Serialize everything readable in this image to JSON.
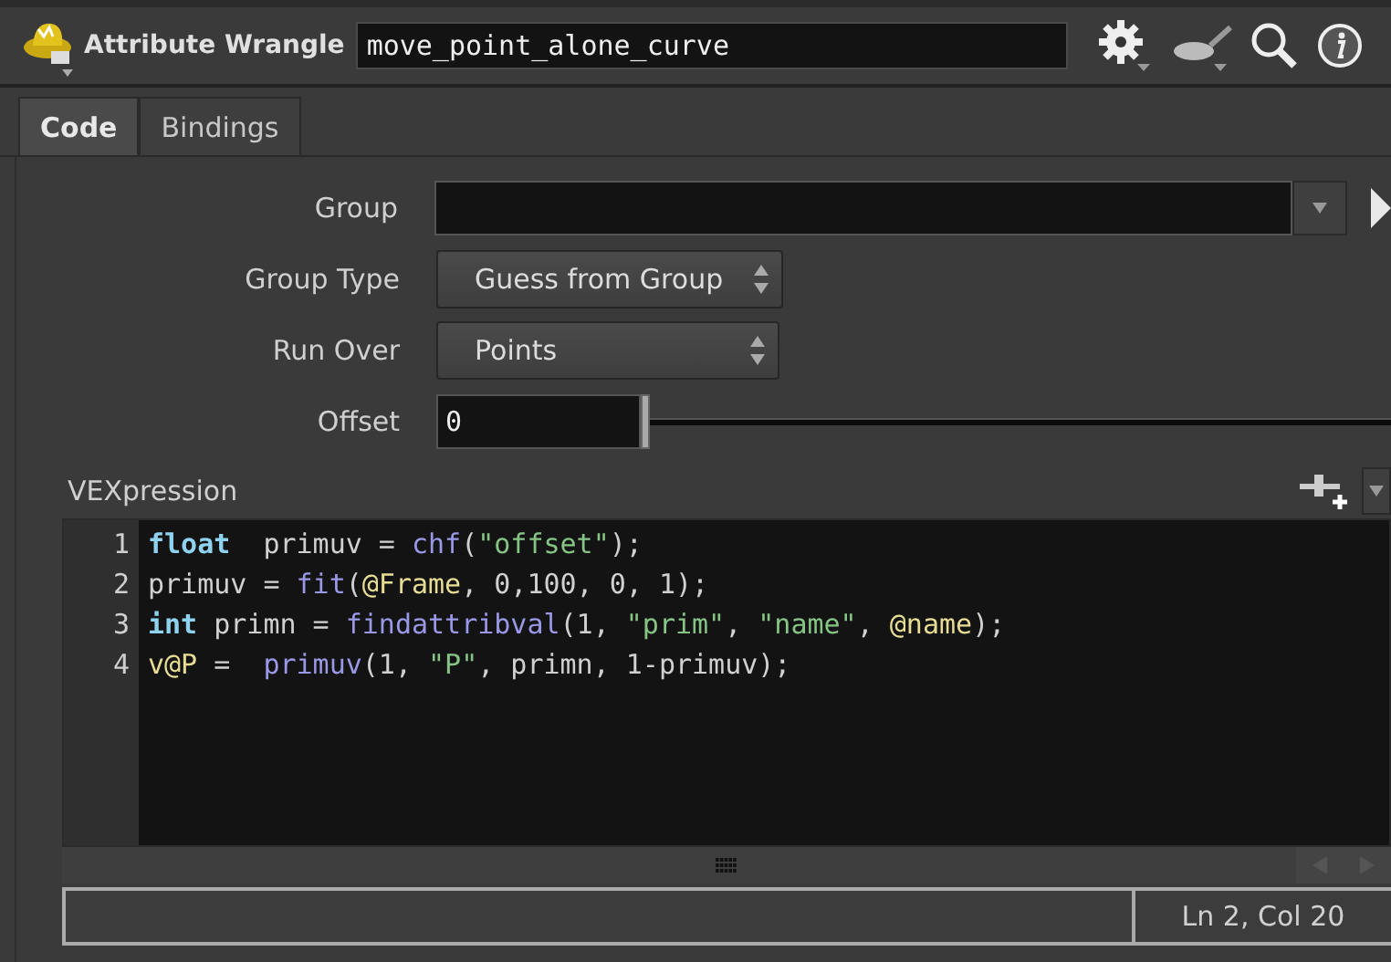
{
  "node": {
    "type_label": "Attribute Wrangle",
    "name": "move_point_alone_curve"
  },
  "tabs": [
    {
      "label": "Code",
      "selected": true
    },
    {
      "label": "Bindings",
      "selected": false
    }
  ],
  "parameters": [
    {
      "kind": "field",
      "label": "Group"
    },
    {
      "kind": "menu",
      "label": "Group Type",
      "value": "Guess from Group"
    },
    {
      "kind": "menu",
      "label": "Run Over",
      "value": "Points"
    },
    {
      "kind": "slider",
      "label": "Offset",
      "value": "0",
      "level": 0
    }
  ],
  "editor": {
    "label": "VEXpression",
    "lines": [
      {
        "number": "1",
        "tokens": [
          {
            "kind": "keyword",
            "text": "float"
          },
          {
            "kind": "plain",
            "text": "  primuv = "
          },
          {
            "kind": "function",
            "text": "chf"
          },
          {
            "kind": "plain",
            "text": "("
          },
          {
            "kind": "string",
            "text": "\"offset\""
          },
          {
            "kind": "plain",
            "text": ");"
          }
        ]
      },
      {
        "number": "2",
        "tokens": [
          {
            "kind": "plain",
            "text": "primuv = "
          },
          {
            "kind": "function",
            "text": "fit"
          },
          {
            "kind": "plain",
            "text": "("
          },
          {
            "kind": "attribute",
            "text": "@Frame"
          },
          {
            "kind": "plain",
            "text": ", 0,100, 0, 1);"
          }
        ]
      },
      {
        "number": "3",
        "tokens": [
          {
            "kind": "keyword",
            "text": "int"
          },
          {
            "kind": "plain",
            "text": " primn = "
          },
          {
            "kind": "function",
            "text": "findattribval"
          },
          {
            "kind": "plain",
            "text": "(1, "
          },
          {
            "kind": "string",
            "text": "\"prim\""
          },
          {
            "kind": "plain",
            "text": ", "
          },
          {
            "kind": "string",
            "text": "\"name\""
          },
          {
            "kind": "plain",
            "text": ", "
          },
          {
            "kind": "attribute",
            "text": "@name"
          },
          {
            "kind": "plain",
            "text": ");"
          }
        ]
      },
      {
        "number": "4",
        "tokens": [
          {
            "kind": "attribute",
            "text": "v@P"
          },
          {
            "kind": "plain",
            "text": " =  "
          },
          {
            "kind": "function",
            "text": "primuv"
          },
          {
            "kind": "plain",
            "text": "(1, "
          },
          {
            "kind": "string",
            "text": "\"P\""
          },
          {
            "kind": "plain",
            "text": ", primn, 1-primuv);"
          }
        ]
      }
    ]
  },
  "status_bar": {
    "position": "Ln 2, Col 20"
  }
}
